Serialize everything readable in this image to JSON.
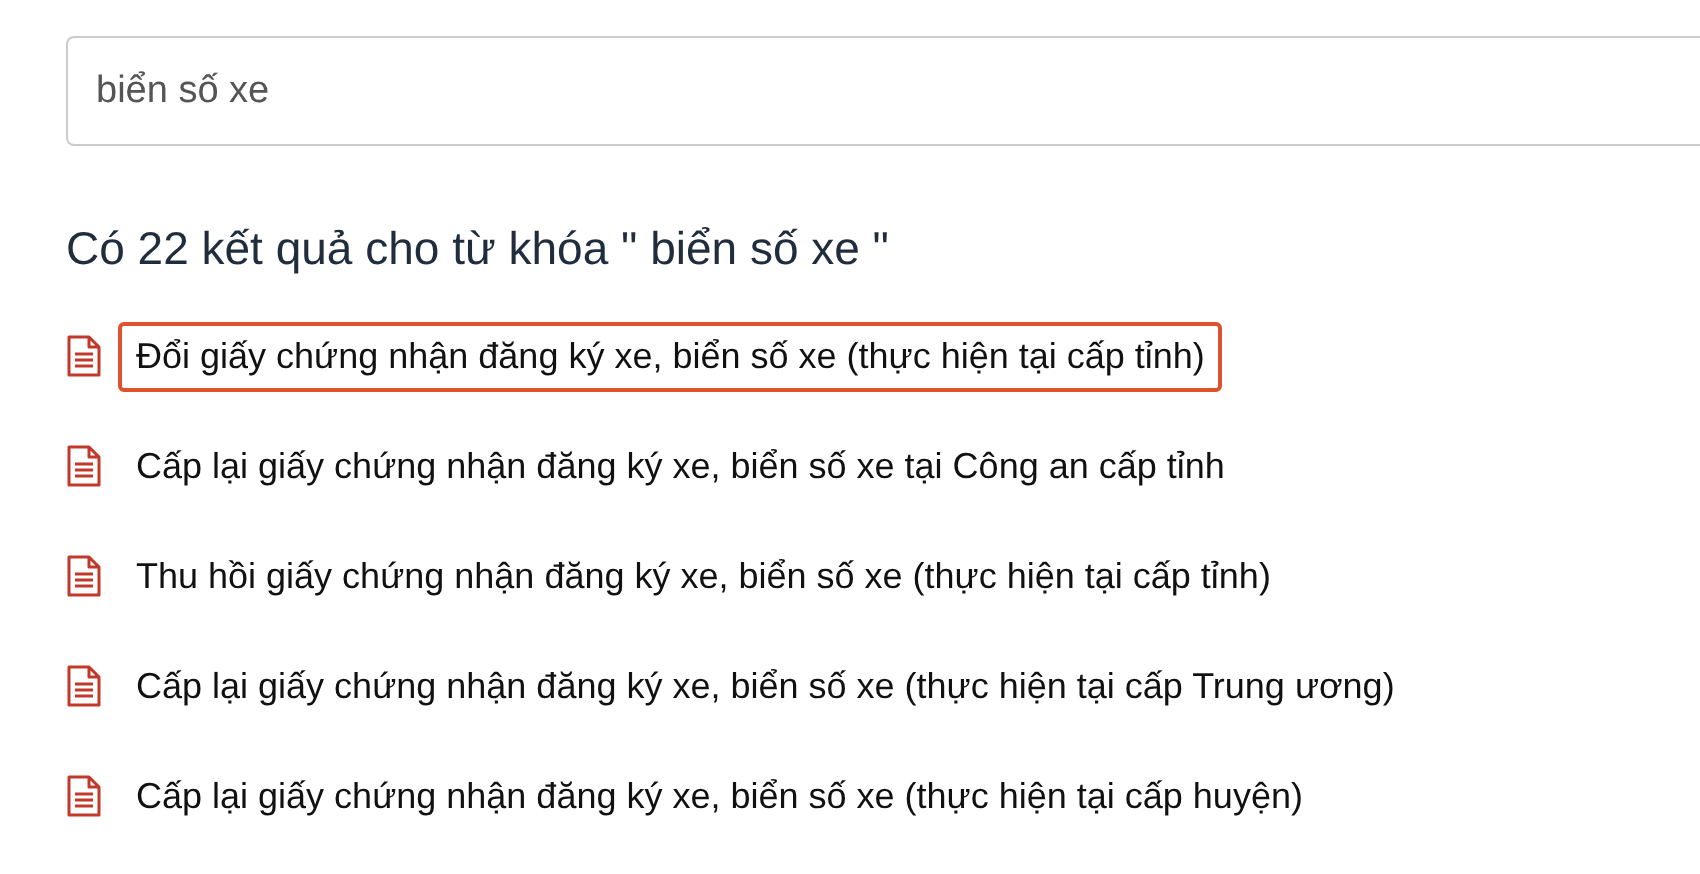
{
  "search": {
    "value": "biển số xe"
  },
  "results_heading": "Có 22 kết quả cho từ khóa \" biển số xe \"",
  "results": [
    {
      "title": "Đổi giấy chứng nhận đăng ký xe, biển số xe (thực hiện tại cấp tỉnh)",
      "highlighted": true
    },
    {
      "title": "Cấp lại giấy chứng nhận đăng ký xe, biển số xe tại Công an cấp tỉnh",
      "highlighted": false
    },
    {
      "title": "Thu hồi giấy chứng nhận đăng ký xe, biển số xe (thực hiện tại cấp tỉnh)",
      "highlighted": false
    },
    {
      "title": "Cấp lại giấy chứng nhận đăng ký xe, biển số xe (thực hiện tại cấp Trung ương)",
      "highlighted": false
    },
    {
      "title": "Cấp lại giấy chứng nhận đăng ký xe, biển số xe (thực hiện tại cấp huyện)",
      "highlighted": false
    }
  ]
}
